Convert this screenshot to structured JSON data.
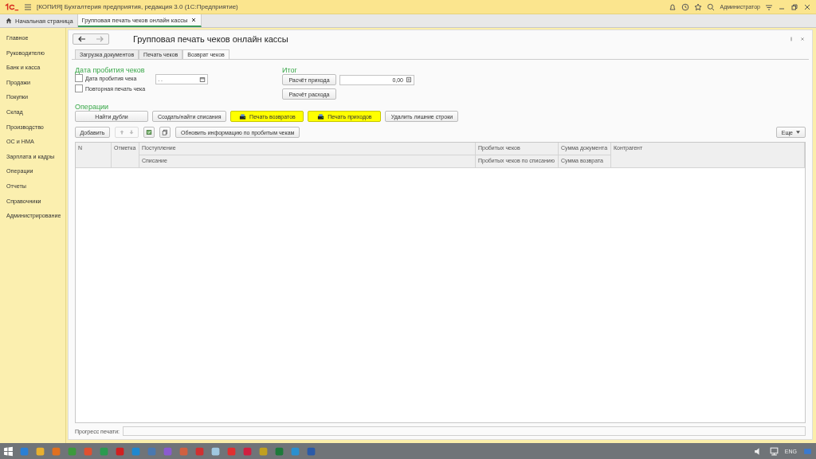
{
  "window": {
    "title": "[КОПИЯ] Бухгалтерия предприятия, редакция 3.0  (1С:Предприятие)",
    "user": "Администратор"
  },
  "open_tabs": [
    {
      "label": "Начальная страница",
      "kind": "home",
      "selected": false
    },
    {
      "label": "Групповая печать чеков онлайн кассы",
      "kind": "doc",
      "selected": true
    }
  ],
  "sidebar": {
    "items": [
      {
        "label": "Главное",
        "selected": false
      },
      {
        "label": "Руководителю",
        "selected": false
      },
      {
        "label": "Банк и касса",
        "selected": false
      },
      {
        "label": "Продажи",
        "selected": false
      },
      {
        "label": "Покупки",
        "selected": false
      },
      {
        "label": "Склад",
        "selected": false
      },
      {
        "label": "Производство",
        "selected": false
      },
      {
        "label": "ОС и НМА",
        "selected": false
      },
      {
        "label": "Зарплата и кадры",
        "selected": false
      },
      {
        "label": "Операции",
        "selected": false
      },
      {
        "label": "Отчеты",
        "selected": false
      },
      {
        "label": "Справочники",
        "selected": false
      },
      {
        "label": "Администрирование",
        "selected": false
      }
    ]
  },
  "form": {
    "title": "Групповая печать чеков онлайн кассы",
    "tabs": [
      {
        "label": "Загрузка документов",
        "selected": false
      },
      {
        "label": "Печать чеков",
        "selected": false
      },
      {
        "label": "Возврат чеков",
        "selected": true
      }
    ],
    "date_section": {
      "heading": "Дата пробития чеков",
      "checkboxes": [
        {
          "label": "Дата пробития чека",
          "checked": false
        },
        {
          "label": "Повторная печать чека",
          "checked": false
        }
      ],
      "date_field": {
        "value": " .  ."
      }
    },
    "total_section": {
      "heading": "Итог",
      "buttons": [
        "Расчёт прихода",
        "Расчёт расхода"
      ],
      "amount": "0,00"
    },
    "operations": {
      "heading": "Операции",
      "buttons": [
        {
          "label": "Найти дубли",
          "kind": "plain"
        },
        {
          "label": "Создать/найти списания",
          "kind": "plain"
        },
        {
          "label": "Печать возвратов",
          "kind": "print"
        },
        {
          "label": "Печать приходов",
          "kind": "print"
        },
        {
          "label": "Удалить лишние строки",
          "kind": "plain"
        }
      ]
    },
    "toolbar": {
      "add": "Добавить",
      "refresh": "Обновить информацию по пробитым чекам",
      "more": "Еще"
    },
    "table": {
      "columns": [
        {
          "top": "N"
        },
        {
          "top": "Отметка"
        },
        {
          "top": "Поступление",
          "bottom": "Списание"
        },
        {
          "top": "Пробитых чеков",
          "bottom": "Пробитых чеков по списанию"
        },
        {
          "top": "Сумма документа",
          "bottom": "Сумма возврата"
        },
        {
          "top": "Контрагент"
        }
      ]
    },
    "progress": {
      "label": "Прогресс печати:"
    }
  },
  "taskbar": {
    "language": "ENG"
  }
}
